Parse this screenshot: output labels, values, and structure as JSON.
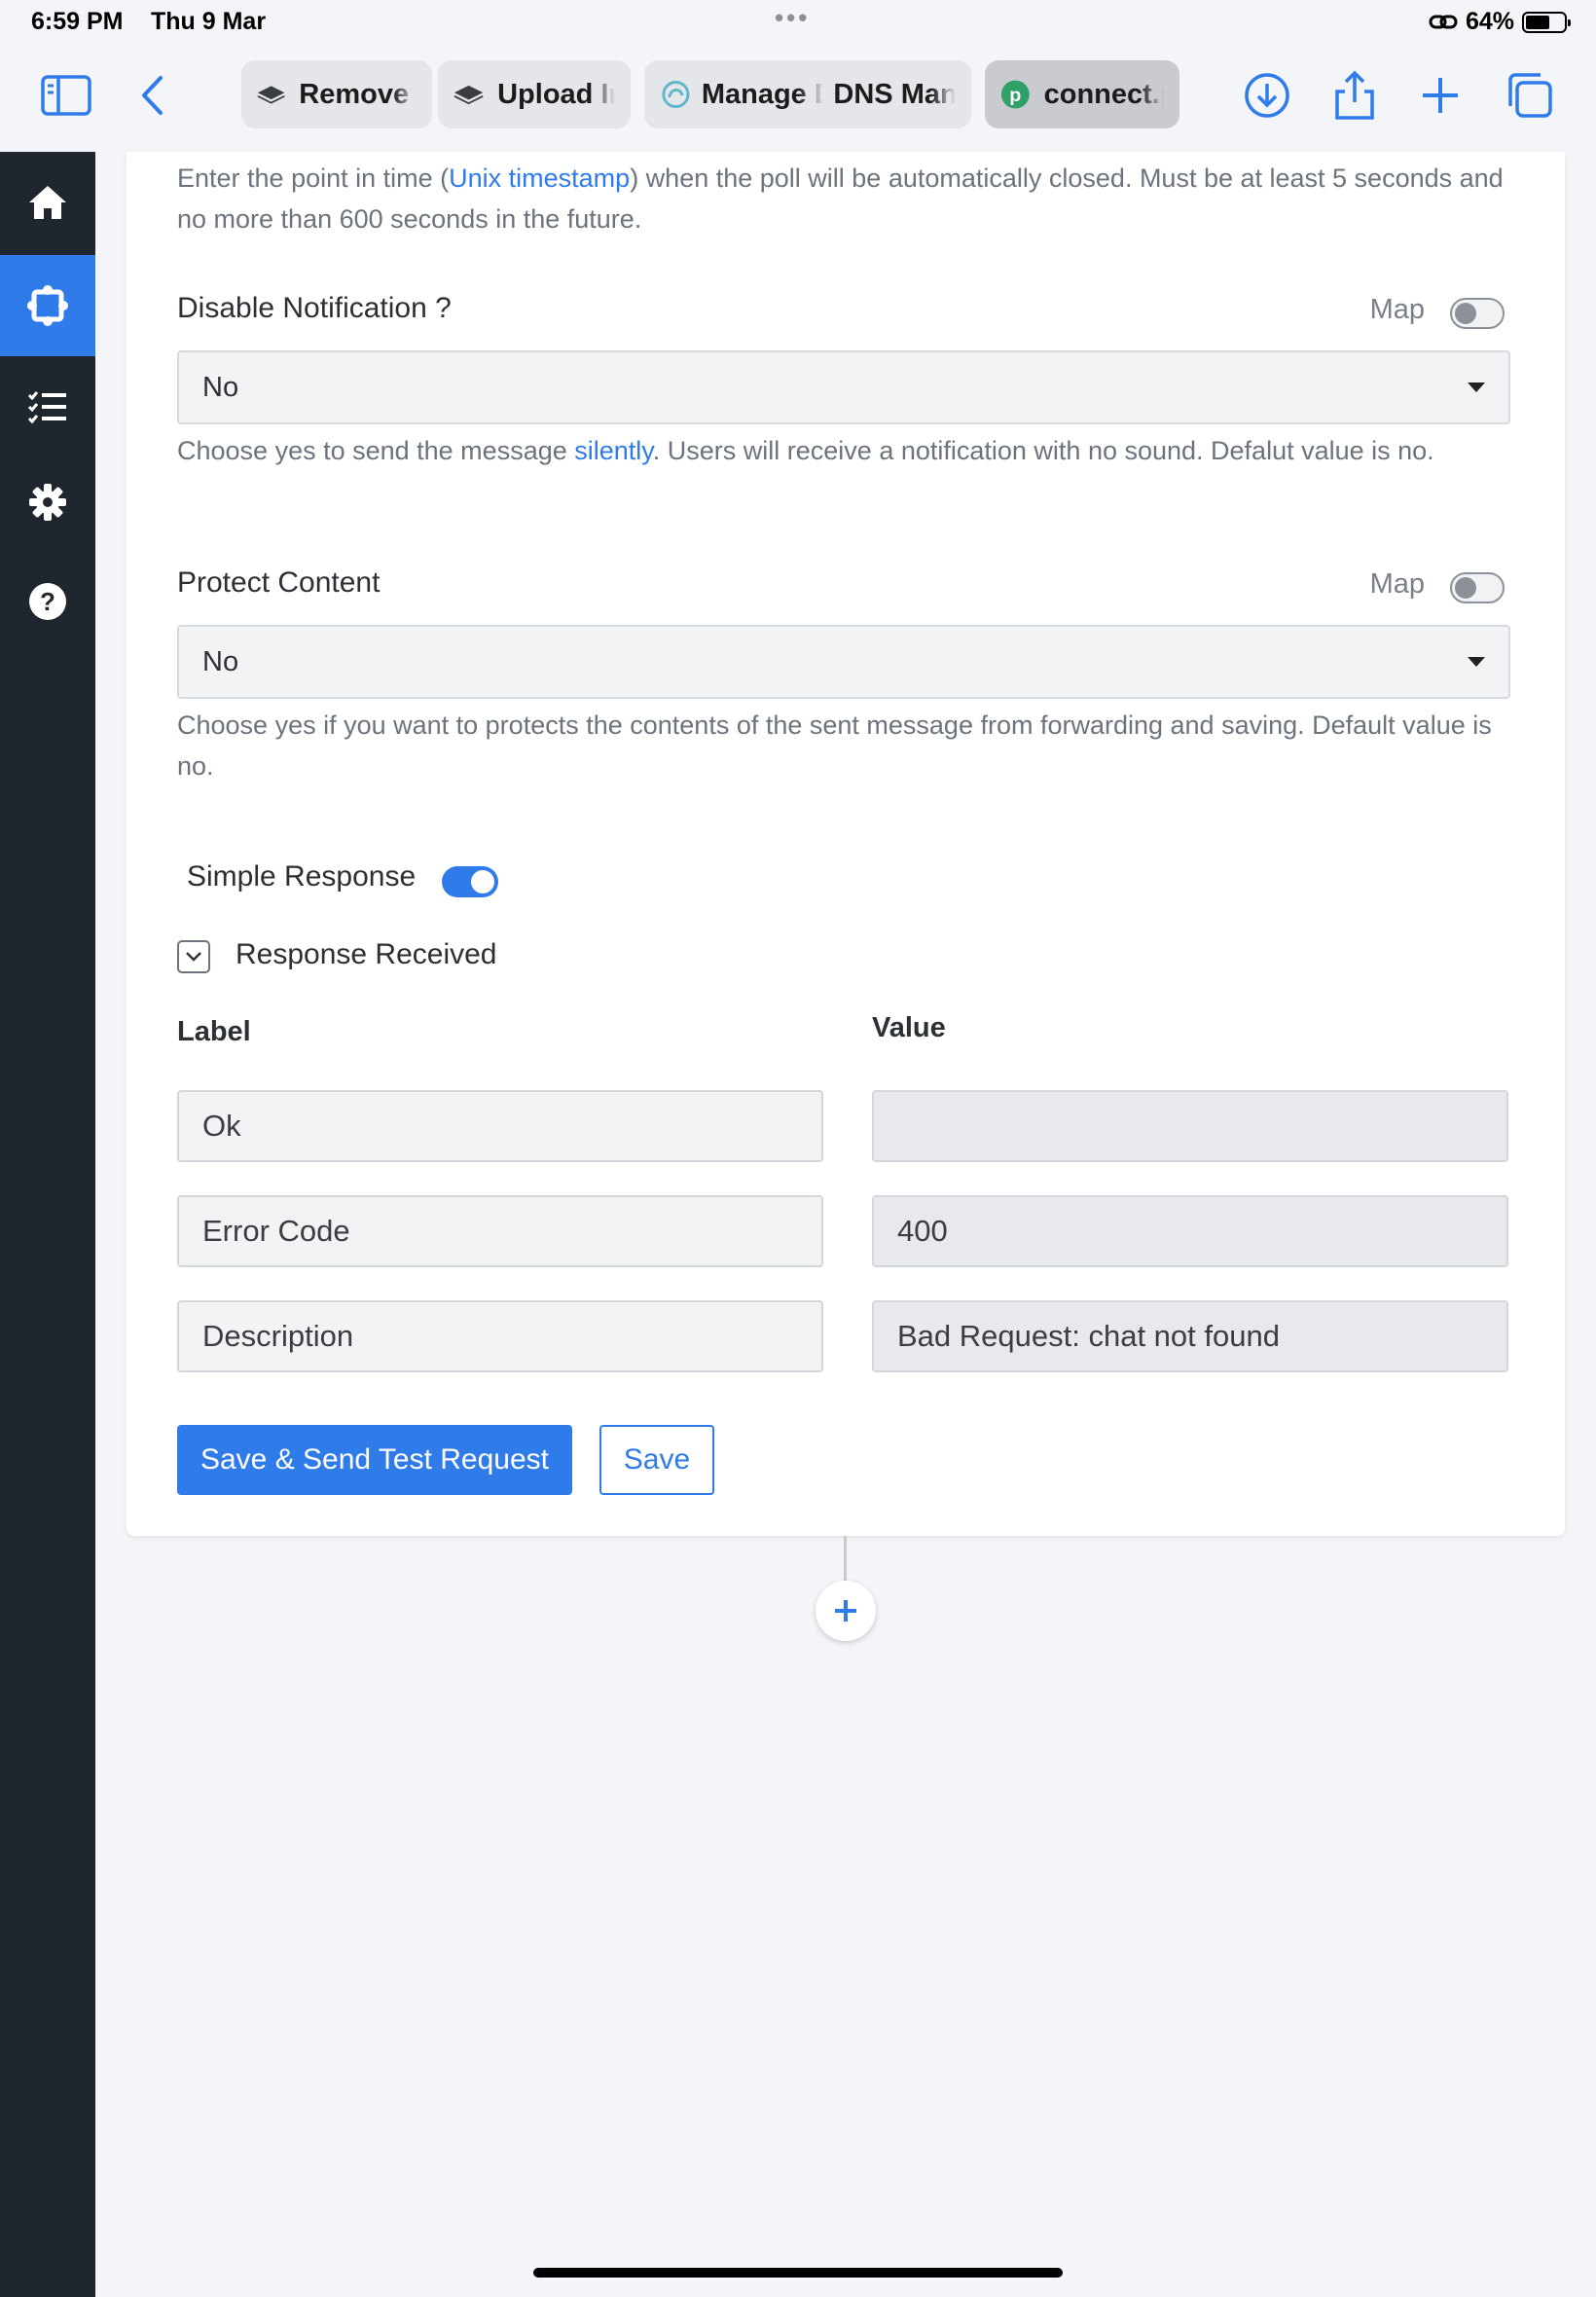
{
  "status_bar": {
    "time": "6:59 PM",
    "date": "Thu 9 Mar",
    "battery": "64%",
    "battery_level": 0.64
  },
  "browser": {
    "tabs": [
      {
        "label": "Remove E",
        "icon": "layers-icon"
      },
      {
        "label": "Upload In",
        "icon": "layers-icon"
      },
      {
        "label": "Manage D",
        "icon": "cloud-swirl-icon"
      },
      {
        "label": "DNS Man",
        "icon": ""
      },
      {
        "label": "connect.p",
        "icon": "pabbly-p-icon"
      }
    ],
    "accent": "#2f7bea"
  },
  "sidebar": {
    "items": [
      {
        "icon": "home-icon"
      },
      {
        "icon": "integration-icon"
      },
      {
        "icon": "task-list-icon"
      },
      {
        "icon": "gear-icon"
      },
      {
        "icon": "help-circle-icon"
      }
    ]
  },
  "form": {
    "close_date_help": {
      "before": "Enter the point in time (",
      "link": "Unix timestamp",
      "after": ") when the poll will be automatically closed. Must be at least 5 seconds and no more than 600 seconds in the future."
    },
    "disable_notification": {
      "label": "Disable Notification ?",
      "map_label": "Map",
      "value": "No",
      "help_before": "Choose yes to send the message ",
      "help_link": "silently",
      "help_after": ". Users will receive a notification with no sound. Defalut value is no."
    },
    "protect_content": {
      "label": "Protect Content",
      "map_label": "Map",
      "value": "No",
      "help": "Choose yes if you want to protects the contents of the sent message from forwarding and saving. Default value is no."
    },
    "simple_response": {
      "label": "Simple Response"
    },
    "response_received": {
      "label": "Response Received"
    },
    "columns": {
      "label": "Label",
      "value": "Value"
    },
    "rows": [
      {
        "label": "Ok",
        "value": ""
      },
      {
        "label": "Error Code",
        "value": "400"
      },
      {
        "label": "Description",
        "value": "Bad Request: chat not found"
      }
    ],
    "buttons": {
      "save_send": "Save & Send Test Request",
      "save": "Save"
    }
  }
}
